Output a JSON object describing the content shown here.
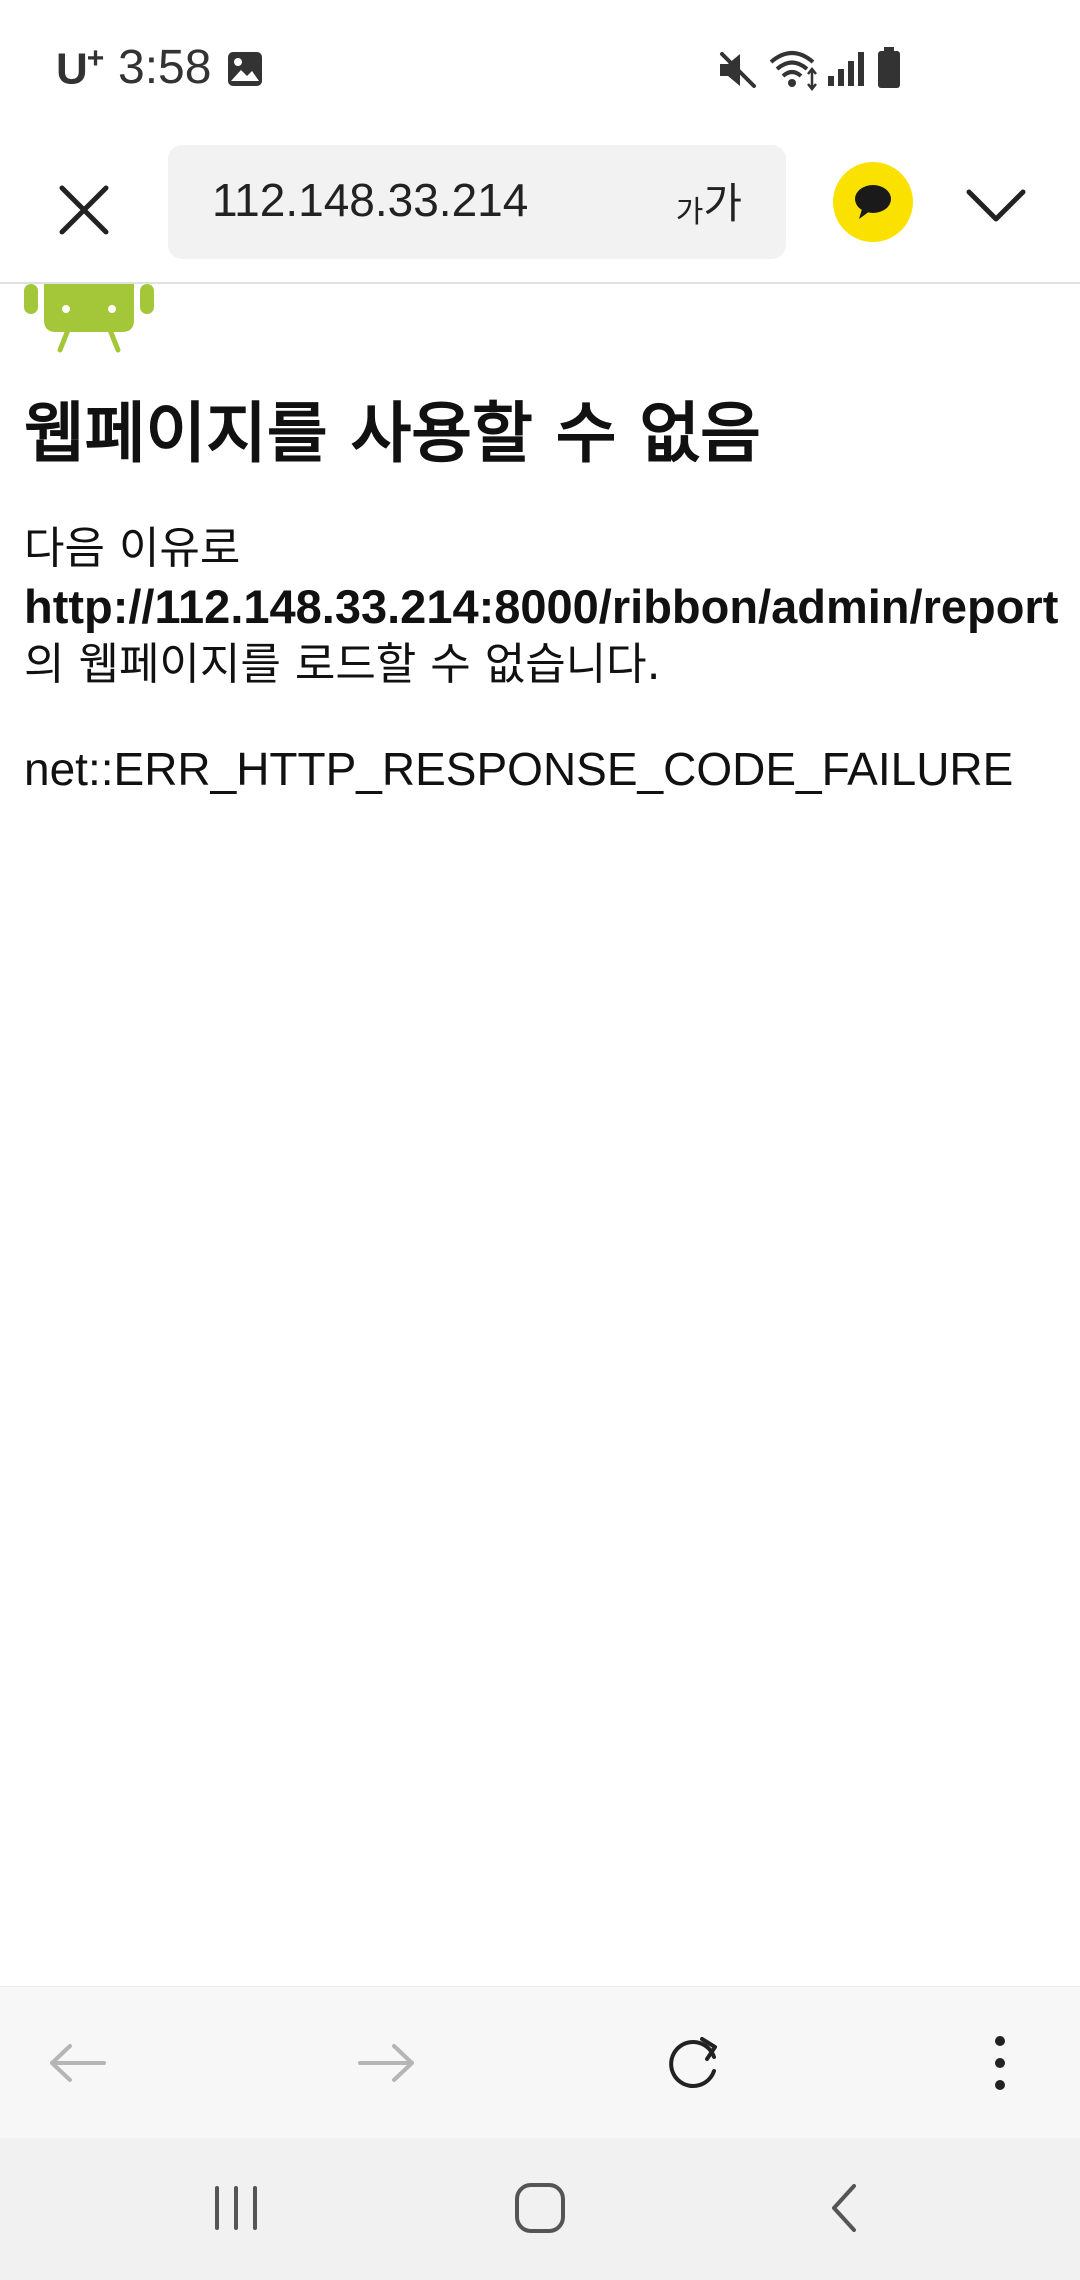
{
  "status_bar": {
    "carrier": "U",
    "carrier_plus": "+",
    "time": "3:58",
    "icons": [
      "gallery-icon",
      "mute-icon",
      "wifi-icon",
      "signal-icon",
      "battery-icon"
    ]
  },
  "toolbar": {
    "url": "112.148.33.214",
    "text_size_small": "가",
    "text_size_big": "가",
    "kakao_color": "#fae100"
  },
  "page": {
    "title": "웹페이지를 사용할 수 없음",
    "body_line1": "다음 이유로",
    "body_url": "http://112.148.33.214:8000/ribbon/admin/report",
    "body_line3": "의 웹페이지를 로드할 수 없습니다.",
    "error_code": "net::ERR_HTTP_RESPONSE_CODE_FAILURE",
    "android_color": "#a4c639"
  },
  "bottom_bar": {
    "icons": [
      "back-arrow-icon",
      "forward-arrow-icon",
      "refresh-icon",
      "more-vert-icon"
    ]
  },
  "nav_bar": {
    "icons": [
      "recents-icon",
      "home-icon",
      "back-icon"
    ]
  }
}
